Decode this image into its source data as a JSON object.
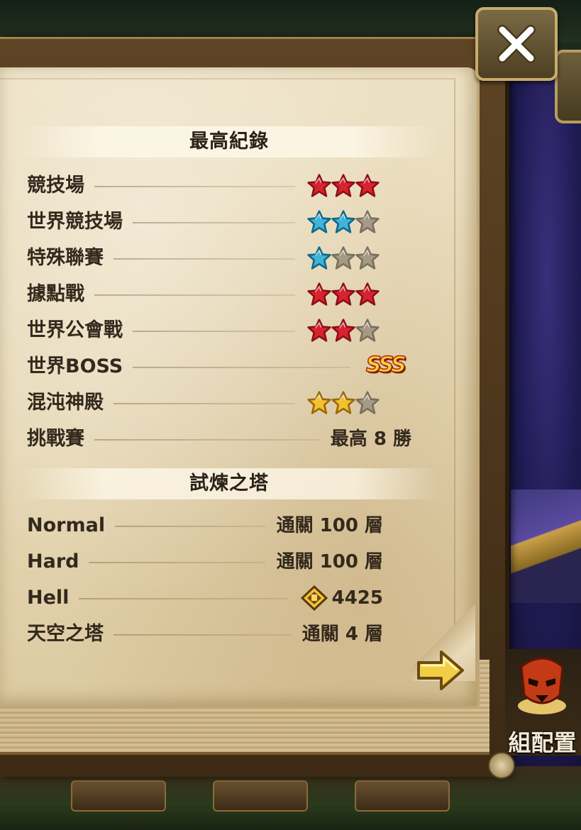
{
  "records": {
    "title": "最高紀錄",
    "rows": [
      {
        "label": "競技場",
        "stars": 3,
        "color": "red"
      },
      {
        "label": "世界競技場",
        "stars": 2,
        "color": "blue"
      },
      {
        "label": "特殊聯賽",
        "stars": 1,
        "color": "blue"
      },
      {
        "label": "據點戰",
        "stars": 3,
        "color": "red"
      },
      {
        "label": "世界公會戰",
        "stars": 2,
        "color": "red"
      },
      {
        "label": "世界BOSS",
        "rank": "SSS"
      },
      {
        "label": "混沌神殿",
        "stars": 2,
        "color": "gold"
      },
      {
        "label": "挑戰賽",
        "value": "最高 8 勝"
      }
    ]
  },
  "tower": {
    "title": "試煉之塔",
    "rows": [
      {
        "label": "Normal",
        "value": "通關 100 層"
      },
      {
        "label": "Hard",
        "value": "通關 100 層"
      },
      {
        "label": "Hell",
        "value": "4425",
        "icon": "trophy-gem-icon"
      },
      {
        "label": "天空之塔",
        "value": "通關 4 層"
      }
    ]
  },
  "side_button": {
    "label": "組配置"
  },
  "colors": {
    "star_red": "#d8232f",
    "star_blue": "#3fb4d8",
    "star_gold": "#f2c12e",
    "star_empty": "#a59a86",
    "page_bg": "#e9dcbd",
    "frame": "#4a3419"
  }
}
